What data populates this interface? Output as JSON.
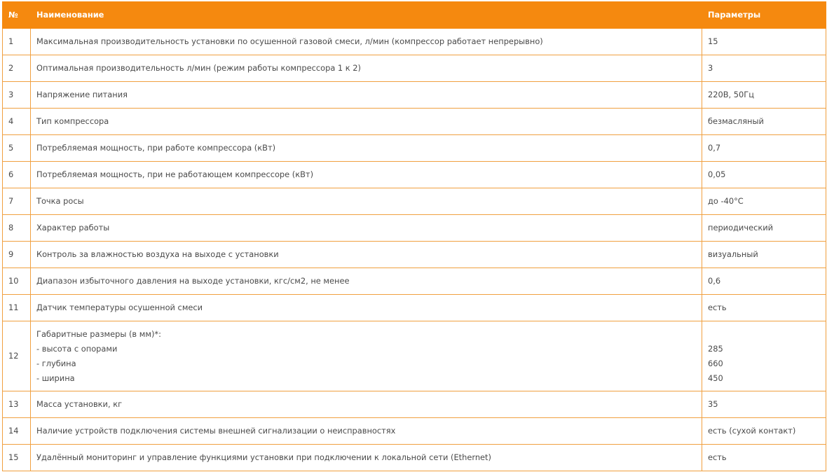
{
  "table": {
    "headers": {
      "num": "№",
      "name": "Наименование",
      "param": "Параметры"
    },
    "rows": [
      {
        "num": "1",
        "name": "Максимальная производительность установки по осушенной газовой смеси, л/мин (компрессор работает непрерывно)",
        "param": "15"
      },
      {
        "num": "2",
        "name": "Оптимальная производительность л/мин (режим работы компрессора 1 к 2)",
        "param": "3"
      },
      {
        "num": "3",
        "name": "Напряжение питания",
        "param": "220В, 50Гц"
      },
      {
        "num": "4",
        "name": "Тип компрессора",
        "param": "безмасляный"
      },
      {
        "num": "5",
        "name": "Потребляемая мощность, при работе компрессора (кВт)",
        "param": "0,7"
      },
      {
        "num": "6",
        "name": "Потребляемая мощность, при не работающем компрессоре (кВт)",
        "param": "0,05"
      },
      {
        "num": "7",
        "name": "Точка росы",
        "param": "до -40°С"
      },
      {
        "num": "8",
        "name": "Характер работы",
        "param": "периодический"
      },
      {
        "num": "9",
        "name": "Контроль за влажностью воздуха на выходе с установки",
        "param": "визуальный"
      },
      {
        "num": "10",
        "name": "Диапазон избыточного давления на выходе установки, кгс/см2, не менее",
        "param": "0,6"
      },
      {
        "num": "11",
        "name": "Датчик температуры осушенной смеси",
        "param": "есть"
      },
      {
        "num": "12",
        "name_lines": [
          "Габаритные размеры (в мм)*:",
          "- высота с опорами",
          "- глубина",
          "- ширина"
        ],
        "param_lines": [
          "285",
          "660",
          "450"
        ]
      },
      {
        "num": "13",
        "name": "Масса установки, кг",
        "param": "35"
      },
      {
        "num": "14",
        "name": "Наличие устройств подключения системы внешней сигнализации о неисправностях",
        "param": "есть (сухой контакт)"
      },
      {
        "num": "15",
        "name": "Удалённый мониторинг и управление функциями установки при подключении к локальной сети (Ethernet)",
        "param": "есть"
      }
    ]
  }
}
